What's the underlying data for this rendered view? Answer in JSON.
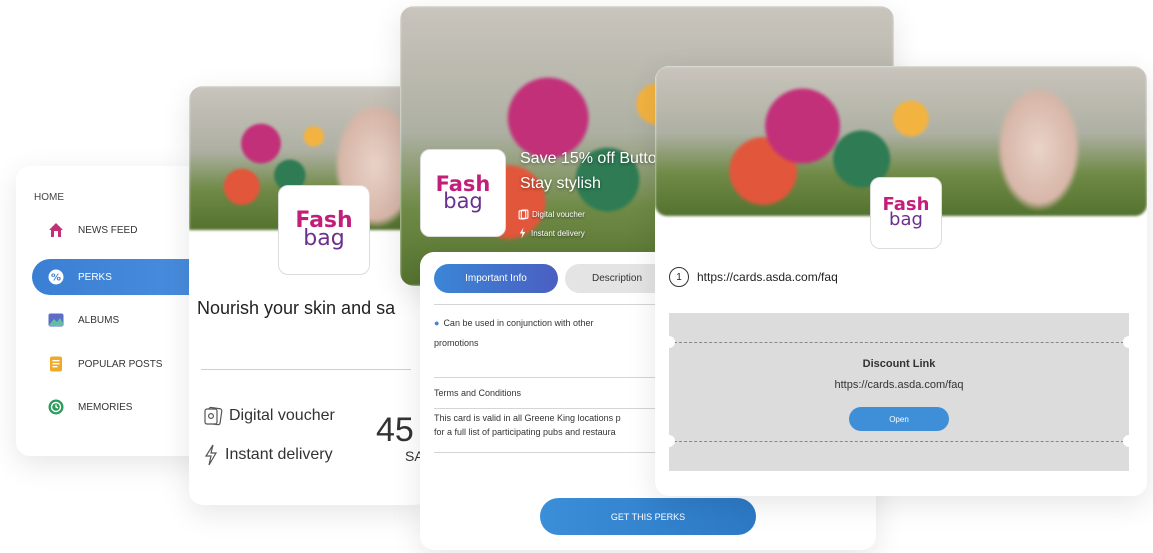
{
  "sidebar": {
    "home_label": "HOME",
    "items": [
      {
        "label": "NEWS FEED",
        "icon": "home-icon",
        "color": "#c2307a"
      },
      {
        "label": "PERKS",
        "icon": "percent-icon",
        "active": true
      },
      {
        "label": "ALBUMS",
        "icon": "image-icon",
        "color": "#5d6bc9"
      },
      {
        "label": "POPULAR POSTS",
        "icon": "document-icon",
        "color": "#f1a92a"
      },
      {
        "label": "MEMORIES",
        "icon": "clock-icon",
        "color": "#2e9b5c"
      }
    ]
  },
  "brand": {
    "line1": "Fash",
    "line2": "bag",
    "primary_color": "#c21f7a",
    "secondary_color": "#6b2f8f"
  },
  "left_card": {
    "title": "Nourish your skin and sa",
    "digital_voucher": "Digital voucher",
    "instant_delivery": "Instant delivery",
    "price": "45",
    "save": "SA"
  },
  "center_card": {
    "headline": "Save 15% off Butto",
    "subheadline": "Stay stylish",
    "digital_voucher": "Digital voucher",
    "instant_delivery": "Instant delivery"
  },
  "info_panel": {
    "tab_important": "Important Info",
    "tab_description": "Description",
    "bullet_line1": "Can be used in conjunction with other",
    "bullet_line2": "promotions",
    "terms_title": "Terms and Conditions",
    "terms_line1": "This card is valid in all Greene King locations p",
    "terms_line2": "for a full list of participating pubs and restaura",
    "cta": "GET THIS PERKS"
  },
  "right_card": {
    "step_number": "1",
    "url": "https://cards.asda.com/faq",
    "discount_title": "Discount Link",
    "discount_url": "https://cards.asda.com/faq",
    "open_label": "Open"
  }
}
